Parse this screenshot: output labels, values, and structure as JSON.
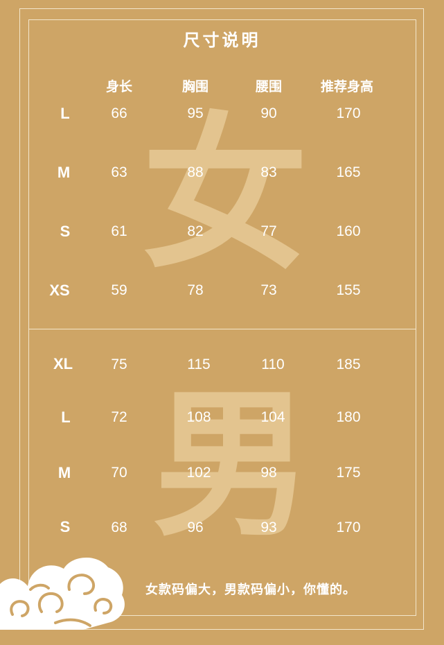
{
  "title": "尺寸说明",
  "watermark_women": "女",
  "watermark_men": "男",
  "headers": [
    "身长",
    "胸围",
    "腰围",
    "推荐身高"
  ],
  "women": [
    {
      "size": "L",
      "length": "66",
      "chest": "95",
      "waist": "90",
      "height": "170"
    },
    {
      "size": "M",
      "length": "63",
      "chest": "88",
      "waist": "83",
      "height": "165"
    },
    {
      "size": "S",
      "length": "61",
      "chest": "82",
      "waist": "77",
      "height": "160"
    },
    {
      "size": "XS",
      "length": "59",
      "chest": "78",
      "waist": "73",
      "height": "155"
    }
  ],
  "men": [
    {
      "size": "XL",
      "length": "75",
      "chest": "115",
      "waist": "110",
      "height": "185"
    },
    {
      "size": "L",
      "length": "72",
      "chest": "108",
      "waist": "104",
      "height": "180"
    },
    {
      "size": "M",
      "length": "70",
      "chest": "102",
      "waist": "98",
      "height": "175"
    },
    {
      "size": "S",
      "length": "68",
      "chest": "96",
      "waist": "93",
      "height": "170"
    }
  ],
  "footer": "女款码偏大，男款码偏小，你懂的。",
  "colors": {
    "background": "#cea566",
    "watermark": "#e3c48f",
    "text": "#ffffff",
    "border": "#f3e6cc"
  }
}
